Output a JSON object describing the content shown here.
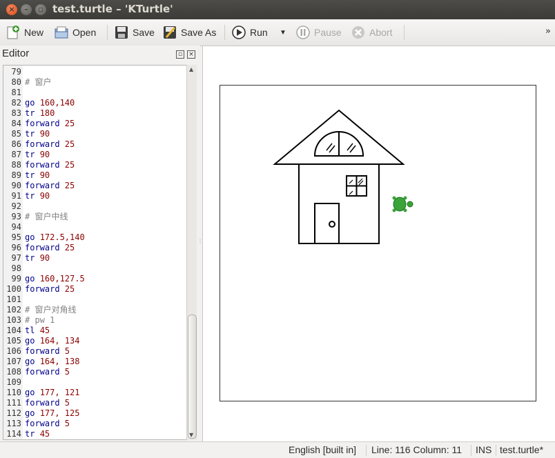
{
  "window": {
    "title": "test.turtle – 'KTurtle'"
  },
  "toolbar": {
    "new": "New",
    "open": "Open",
    "save": "Save",
    "save_as": "Save As",
    "run": "Run",
    "pause": "Pause",
    "abort": "Abort",
    "more": "»"
  },
  "editor": {
    "title": "Editor",
    "lines": [
      {
        "n": "79",
        "t": []
      },
      {
        "n": "80",
        "t": [
          [
            "cm",
            "# 窗户"
          ]
        ]
      },
      {
        "n": "81",
        "t": []
      },
      {
        "n": "82",
        "t": [
          [
            "kw",
            "go "
          ],
          [
            "num",
            "160,140"
          ]
        ]
      },
      {
        "n": "83",
        "t": [
          [
            "kw",
            "tr "
          ],
          [
            "num",
            "180"
          ]
        ]
      },
      {
        "n": "84",
        "t": [
          [
            "kw",
            "forward "
          ],
          [
            "num",
            "25"
          ]
        ]
      },
      {
        "n": "85",
        "t": [
          [
            "kw",
            "tr "
          ],
          [
            "num",
            "90"
          ]
        ]
      },
      {
        "n": "86",
        "t": [
          [
            "kw",
            "forward "
          ],
          [
            "num",
            "25"
          ]
        ]
      },
      {
        "n": "87",
        "t": [
          [
            "kw",
            "tr "
          ],
          [
            "num",
            "90"
          ]
        ]
      },
      {
        "n": "88",
        "t": [
          [
            "kw",
            "forward "
          ],
          [
            "num",
            "25"
          ]
        ]
      },
      {
        "n": "89",
        "t": [
          [
            "kw",
            "tr "
          ],
          [
            "num",
            "90"
          ]
        ]
      },
      {
        "n": "90",
        "t": [
          [
            "kw",
            "forward "
          ],
          [
            "num",
            "25"
          ]
        ]
      },
      {
        "n": "91",
        "t": [
          [
            "kw",
            "tr "
          ],
          [
            "num",
            "90"
          ]
        ]
      },
      {
        "n": "92",
        "t": []
      },
      {
        "n": "93",
        "t": [
          [
            "cm",
            "# 窗户中线"
          ]
        ]
      },
      {
        "n": "94",
        "t": []
      },
      {
        "n": "95",
        "t": [
          [
            "kw",
            "go "
          ],
          [
            "num",
            "172.5,140"
          ]
        ]
      },
      {
        "n": "96",
        "t": [
          [
            "kw",
            "forward "
          ],
          [
            "num",
            "25"
          ]
        ]
      },
      {
        "n": "97",
        "t": [
          [
            "kw",
            "tr "
          ],
          [
            "num",
            "90"
          ]
        ]
      },
      {
        "n": "98",
        "t": []
      },
      {
        "n": "99",
        "t": [
          [
            "kw",
            "go "
          ],
          [
            "num",
            "160,127.5"
          ]
        ]
      },
      {
        "n": "100",
        "t": [
          [
            "kw",
            "forward "
          ],
          [
            "num",
            "25"
          ]
        ]
      },
      {
        "n": "101",
        "t": []
      },
      {
        "n": "102",
        "t": [
          [
            "cm",
            "# 窗户对角线"
          ]
        ]
      },
      {
        "n": "103",
        "t": [
          [
            "cm",
            "# pw 1"
          ]
        ]
      },
      {
        "n": "104",
        "t": [
          [
            "kw",
            "tl "
          ],
          [
            "num",
            "45"
          ]
        ]
      },
      {
        "n": "105",
        "t": [
          [
            "kw",
            "go "
          ],
          [
            "num",
            "164, 134"
          ]
        ]
      },
      {
        "n": "106",
        "t": [
          [
            "kw",
            "forward "
          ],
          [
            "num",
            "5"
          ]
        ]
      },
      {
        "n": "107",
        "t": [
          [
            "kw",
            "go "
          ],
          [
            "num",
            "164, 138"
          ]
        ]
      },
      {
        "n": "108",
        "t": [
          [
            "kw",
            "forward "
          ],
          [
            "num",
            "5"
          ]
        ]
      },
      {
        "n": "109",
        "t": []
      },
      {
        "n": "110",
        "t": [
          [
            "kw",
            "go "
          ],
          [
            "num",
            "177, 121"
          ]
        ]
      },
      {
        "n": "111",
        "t": [
          [
            "kw",
            "forward "
          ],
          [
            "num",
            "5"
          ]
        ]
      },
      {
        "n": "112",
        "t": [
          [
            "kw",
            "go "
          ],
          [
            "num",
            "177, 125"
          ]
        ]
      },
      {
        "n": "113",
        "t": [
          [
            "kw",
            "forward "
          ],
          [
            "num",
            "5"
          ]
        ]
      },
      {
        "n": "114",
        "t": [
          [
            "kw",
            "tr "
          ],
          [
            "num",
            "45"
          ]
        ]
      }
    ]
  },
  "status": {
    "language": "English [built in]",
    "position": "Line: 116 Column: 11",
    "mode": "INS",
    "file": "test.turtle*"
  },
  "colors": {
    "keyword": "#00008b",
    "number": "#8b0000",
    "comment": "#808080",
    "turtle": "#3aa33a"
  }
}
